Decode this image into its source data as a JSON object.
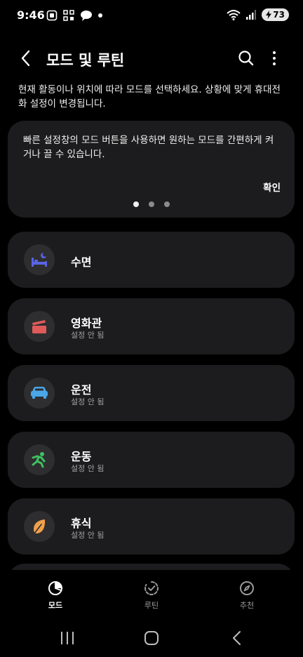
{
  "status": {
    "time": "9:46",
    "battery": "73"
  },
  "header": {
    "title": "모드 및 루틴"
  },
  "intro": {
    "text": "현재 활동이나 위치에 따라 모드를 선택하세요. 상황에 맞게 휴대전화 설정이 변경됩니다."
  },
  "tip": {
    "text": "빠른 설정창의 모드 버튼을 사용하면 원하는 모드를 간편하게 켜거나 끌 수 있습니다.",
    "confirm": "확인",
    "page_count": 3,
    "active_page": 1
  },
  "modes": [
    {
      "label": "수면",
      "sub": "",
      "icon": "bed-icon",
      "color": "#5a64e6"
    },
    {
      "label": "영화관",
      "sub": "설정 안 됨",
      "icon": "clapperboard-icon",
      "color": "#e05a5a"
    },
    {
      "label": "운전",
      "sub": "설정 안 됨",
      "icon": "car-icon",
      "color": "#4aa6e8"
    },
    {
      "label": "운동",
      "sub": "설정 안 됨",
      "icon": "running-icon",
      "color": "#3fc160"
    },
    {
      "label": "휴식",
      "sub": "설정 안 됨",
      "icon": "leaf-icon",
      "color": "#f0a04a"
    }
  ],
  "nav": {
    "items": [
      {
        "label": "모드",
        "icon": "modes-icon",
        "active": true
      },
      {
        "label": "루틴",
        "icon": "routine-icon",
        "active": false
      },
      {
        "label": "추천",
        "icon": "compass-icon",
        "active": false
      }
    ]
  },
  "colors": {
    "background": "#000000",
    "card": "#1c1c1e",
    "icon_bg": "#2e2e30"
  }
}
